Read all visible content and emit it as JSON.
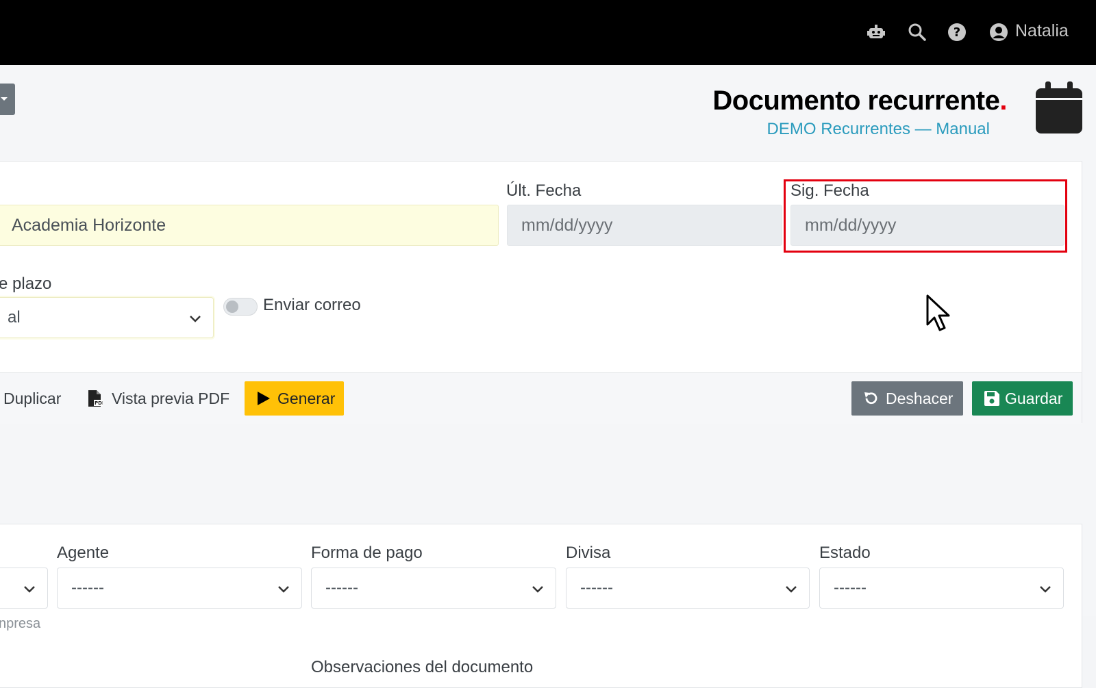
{
  "topbar": {
    "icons": [
      "robot-icon",
      "search-icon",
      "help-icon",
      "user-icon"
    ],
    "user_name": "Natalia"
  },
  "header": {
    "title": "Documento recurrente",
    "title_dot": ".",
    "subtitle": "DEMO Recurrentes — Manual",
    "icon": "calendar-icon"
  },
  "form": {
    "client_value": "Academia Horizonte",
    "last_date_label": "Últ. Fecha",
    "last_date_placeholder": "mm/dd/yyyy",
    "next_date_label": "Sig. Fecha",
    "next_date_placeholder": "mm/dd/yyyy",
    "term_label": "e plazo",
    "term_value": "al",
    "send_email_label": "Enviar correo",
    "send_email_on": false
  },
  "actions": {
    "duplicate": "Duplicar",
    "preview_pdf": "Vista previa PDF",
    "generate": "Generar",
    "undo": "Deshacer",
    "save": "Guardar"
  },
  "details": {
    "company_help": "npresa",
    "agent_label": "Agente",
    "agent_value": "------",
    "payment_label": "Forma de pago",
    "payment_value": "------",
    "currency_label": "Divisa",
    "currency_value": "------",
    "status_label": "Estado",
    "status_value": "------",
    "notes_label": "Observaciones del documento"
  },
  "colors": {
    "accent_red": "#e3000f",
    "subtitle_teal": "#2a9bbd",
    "generate_yellow": "#ffc107",
    "save_green": "#198754",
    "undo_grey": "#6c757d"
  }
}
